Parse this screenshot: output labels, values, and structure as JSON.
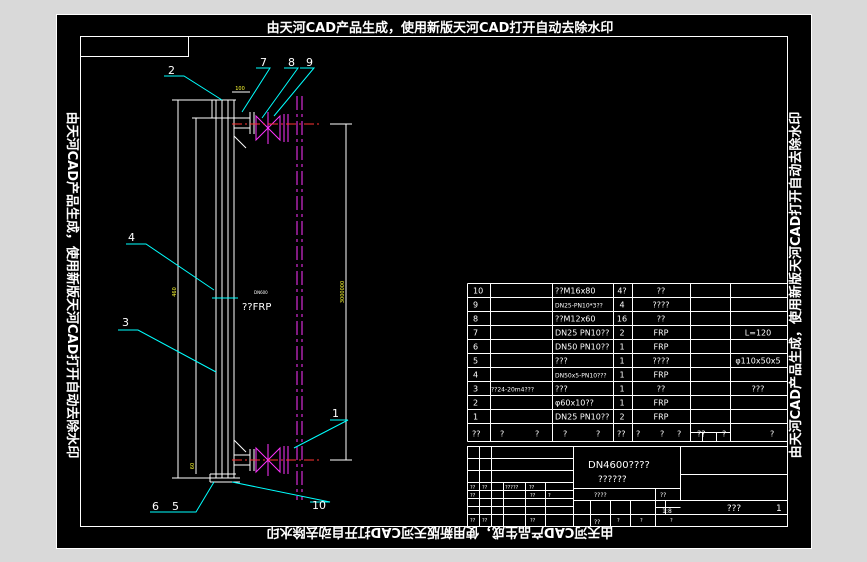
{
  "watermark": "由天河CAD产品生成，使用新版天河CAD打开自动去除水印",
  "balloons": [
    "2",
    "7",
    "8",
    "9",
    "4",
    "3",
    "1",
    "6",
    "5",
    "10"
  ],
  "dims": {
    "top_width": "100",
    "left_total": "460",
    "left_bottom": "60",
    "right_height": "3000000",
    "center_note": "DN600"
  },
  "center_label": "??FRP",
  "bom_rows": [
    {
      "no": "10",
      "name": "??M16x80",
      "qty": "4?",
      "mat": "??",
      "note": ""
    },
    {
      "no": "9",
      "name": "DN25-PN10*3??",
      "qty": "4",
      "mat": "????",
      "note": ""
    },
    {
      "no": "8",
      "name": "??M12x60",
      "qty": "16",
      "mat": "??",
      "note": ""
    },
    {
      "no": "7",
      "name": "DN25 PN10??",
      "qty": "2",
      "mat": "FRP",
      "note": "L=120"
    },
    {
      "no": "6",
      "name": "DN50 PN10??",
      "qty": "1",
      "mat": "FRP",
      "note": ""
    },
    {
      "no": "5",
      "name": "???",
      "qty": "1",
      "mat": "????",
      "note": "φ110x50x5"
    },
    {
      "no": "4",
      "name": "DN50x5-PN10???",
      "qty": "1",
      "mat": "FRP",
      "note": ""
    },
    {
      "no": "3",
      "name": "???",
      "qty": "1",
      "mat": "??",
      "note": "???",
      "code": "??24-20m4???"
    },
    {
      "no": "2",
      "name": "φ60x10??",
      "qty": "1",
      "mat": "FRP",
      "note": ""
    },
    {
      "no": "1",
      "name": "DN25 PN10??",
      "qty": "2",
      "mat": "FRP",
      "note": ""
    }
  ],
  "bom_header": [
    "??",
    "?",
    "?",
    "?",
    "?",
    "??",
    "?",
    "?",
    "?",
    "??",
    "?",
    "?"
  ],
  "title_block": {
    "title": "DN4600????",
    "subtitle": "??????",
    "drawing_name": "???",
    "sheet": "1",
    "scale": "1:8",
    "row_a": [
      "??",
      "??",
      "?????",
      "??"
    ],
    "row_b": [
      "??",
      "??",
      "?"
    ],
    "row_c": [
      "??",
      "??",
      "??",
      "?",
      "?",
      "?"
    ],
    "mid": [
      "????",
      "??",
      "??"
    ]
  }
}
